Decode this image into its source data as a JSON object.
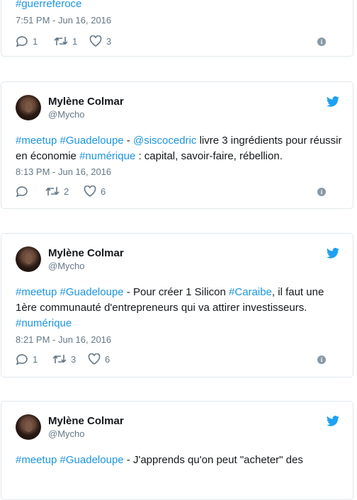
{
  "tweet0": {
    "text_tail": "#guerreferoce",
    "time": "7:51 PM - Jun 16, 2016",
    "replies": "1",
    "retweets": "1",
    "likes": "3"
  },
  "tweet1": {
    "name": "Mylène Colmar",
    "handle": "@Mycho",
    "t1": "#meetup",
    "t2": " ",
    "t3": "#Guadeloupe",
    "t4": " - ",
    "t5": "@siscocedric",
    "t6": " livre 3 ingrédients pour réussir en économie ",
    "t7": "#numérique",
    "t8": " : capital, savoir-faire, rébellion.",
    "time": "8:13 PM - Jun 16, 2016",
    "replies": "",
    "retweets": "2",
    "likes": "6"
  },
  "tweet2": {
    "name": "Mylène Colmar",
    "handle": "@Mycho",
    "t1": "#meetup",
    "t2": " ",
    "t3": "#Guadeloupe",
    "t4": " - Pour créer 1 Silicon ",
    "t5": "#Caraibe",
    "t6": ", il faut une 1ère communauté d'entrepreneurs qui va attirer investisseurs. ",
    "t7": "#numérique",
    "time": "8:21 PM - Jun 16, 2016",
    "replies": "1",
    "retweets": "3",
    "likes": "6"
  },
  "tweet3": {
    "name": "Mylène Colmar",
    "handle": "@Mycho",
    "t1": "#meetup",
    "t2": " ",
    "t3": "#Guadeloupe",
    "t4": " - J'apprends qu'on peut \"acheter\" des"
  },
  "colors": {
    "link": "#1b95e0",
    "twitter_blue": "#1da1f2",
    "muted": "#657786",
    "border": "#e1e8ed"
  },
  "icons": [
    "reply-icon",
    "retweet-icon",
    "like-icon",
    "info-icon",
    "twitter-bird-icon"
  ]
}
